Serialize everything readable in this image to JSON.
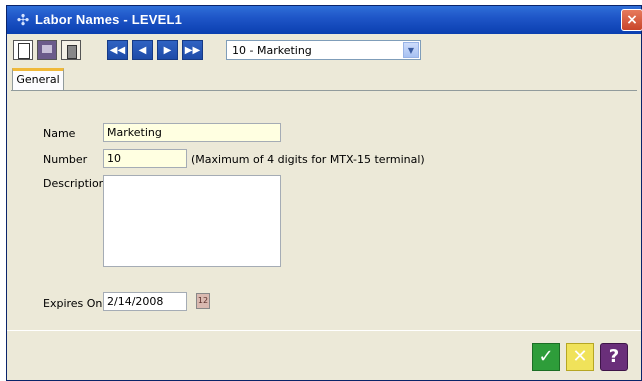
{
  "window": {
    "title": "Labor Names - LEVEL1",
    "close_glyph": "×"
  },
  "toolbar": {
    "nav_first": "◀◀",
    "nav_prev": "◀",
    "nav_next": "▶",
    "nav_last": "▶▶",
    "record_selector": {
      "value": "10 - Marketing",
      "arrow": "▼"
    }
  },
  "tabs": [
    {
      "label": "General",
      "selected": true
    }
  ],
  "form": {
    "name": {
      "label": "Name",
      "value": "Marketing"
    },
    "number": {
      "label": "Number",
      "value": "10",
      "note": "(Maximum of 4 digits for MTX-15 terminal)"
    },
    "description": {
      "label": "Description",
      "value": ""
    },
    "expires_on": {
      "label": "Expires On",
      "value": "2/14/2008",
      "calendar_glyph": "12"
    }
  },
  "footer": {
    "ok_glyph": "✓",
    "cancel_glyph": "✕",
    "help_glyph": "?"
  },
  "colors": {
    "titlebar": "#1f56c8",
    "field_bg": "#ffffe1",
    "tab_accent": "#f0b93a",
    "ok": "#2e9d3a",
    "cancel": "#f0e25a",
    "help": "#6a2f7a"
  }
}
